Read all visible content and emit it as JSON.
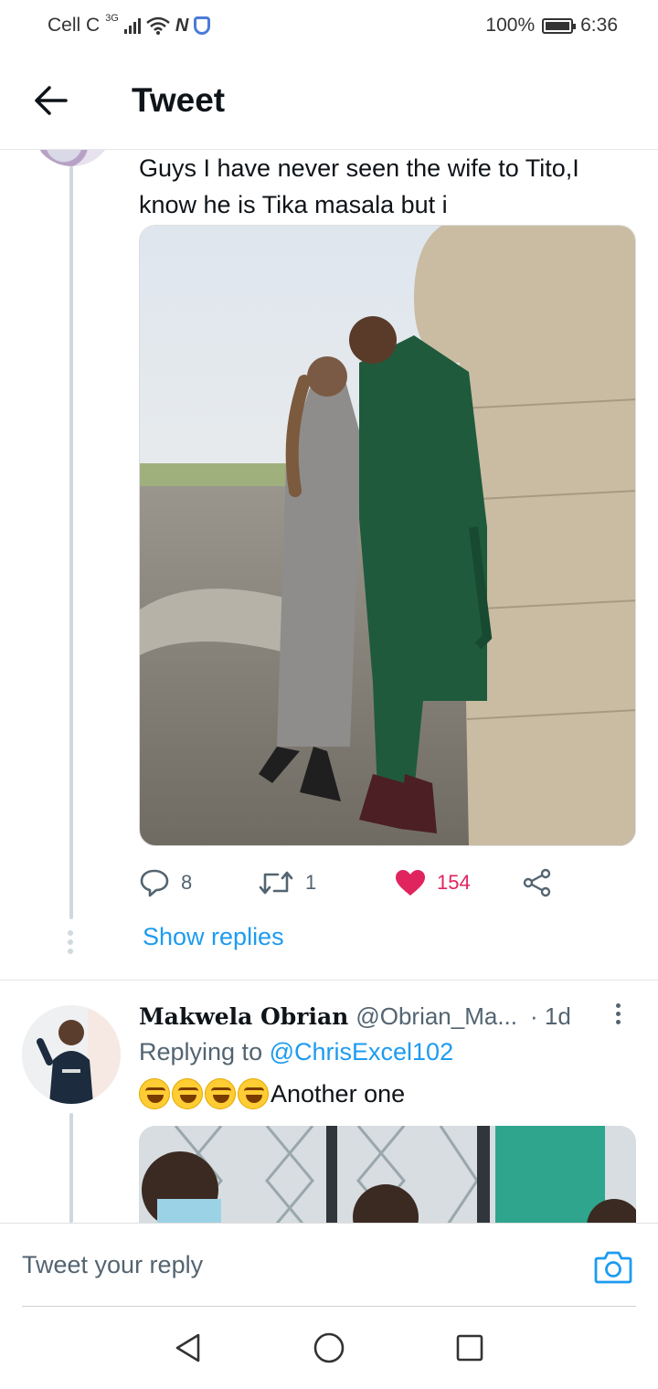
{
  "status_bar": {
    "carrier": "Cell C",
    "network_type": "3G",
    "battery_percent": "100%",
    "time": "6:36",
    "icons": [
      "signal-icon",
      "wifi-icon",
      "n-badge-icon",
      "shield-icon",
      "battery-icon"
    ]
  },
  "header": {
    "title": "Tweet",
    "back_icon": "arrow-left-icon"
  },
  "tweet1": {
    "text_line1": "Guys I have never seen the wife to Tito,I",
    "text_line2": "know he is Tika masala but i",
    "replies_count": "8",
    "retweets_count": "1",
    "likes_count": "154",
    "liked": true,
    "show_replies_label": "Show replies"
  },
  "tweet2": {
    "display_name": "Makwela Obrian",
    "handle": "@Obrian_Ma...",
    "time": "· 1d",
    "replying_prefix": "Replying to",
    "replying_handle": "@ChrisExcel102",
    "text": "Another one",
    "emojis": [
      "rofl-emoji",
      "rofl-emoji",
      "rofl-emoji",
      "joy-emoji"
    ]
  },
  "reply_box": {
    "placeholder": "Tweet your reply",
    "camera_icon": "camera-icon"
  },
  "nav_bar": {
    "icons": [
      "back-triangle-icon",
      "home-circle-icon",
      "recents-square-icon"
    ]
  },
  "colors": {
    "accent": "#1d9bf0",
    "like": "#e0245e",
    "muted": "#536471",
    "text": "#0f1419"
  }
}
